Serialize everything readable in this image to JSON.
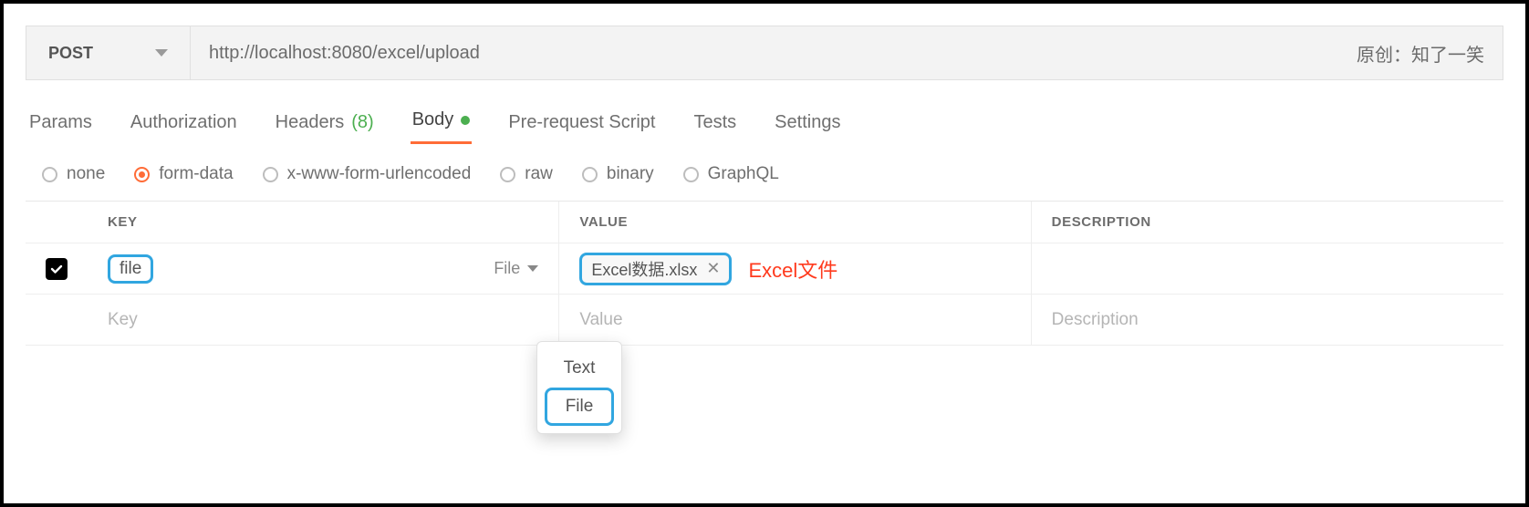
{
  "request": {
    "method": "POST",
    "url": "http://localhost:8080/excel/upload"
  },
  "attribution": "原创：知了一笑",
  "tabs": {
    "params": "Params",
    "authorization": "Authorization",
    "headers_label": "Headers",
    "headers_count": "(8)",
    "body": "Body",
    "prerequest": "Pre-request Script",
    "tests": "Tests",
    "settings": "Settings",
    "active": "Body"
  },
  "body_types": {
    "none": "none",
    "form_data": "form-data",
    "urlencoded": "x-www-form-urlencoded",
    "raw": "raw",
    "binary": "binary",
    "graphql": "GraphQL",
    "selected": "form-data"
  },
  "table": {
    "headers": {
      "key": "KEY",
      "value": "VALUE",
      "description": "DESCRIPTION"
    },
    "rows": [
      {
        "checked": true,
        "key": "file",
        "type": "File",
        "value_filename": "Excel数据.xlsx",
        "annotation": "Excel文件"
      }
    ],
    "placeholder_row": {
      "key": "Key",
      "value": "Value",
      "description": "Description"
    }
  },
  "type_dropdown": {
    "options": [
      "Text",
      "File"
    ],
    "selected": "File"
  }
}
